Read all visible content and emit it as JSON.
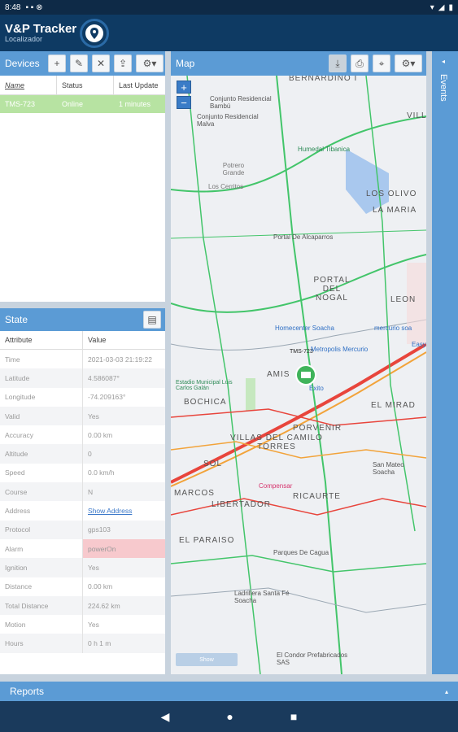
{
  "status": {
    "time": "8:48"
  },
  "app": {
    "title": "V&P Tracker",
    "subtitle": "Localizador"
  },
  "devices": {
    "title": "Devices",
    "columns": [
      "Name",
      "Status",
      "Last Update"
    ],
    "rows": [
      {
        "name": "TMS-723",
        "status": "Online",
        "last_update": "1 minutes"
      }
    ]
  },
  "state": {
    "title": "State",
    "columns": [
      "Attribute",
      "Value"
    ],
    "rows": [
      {
        "attr": "Time",
        "value": "2021-03-03 21:19:22"
      },
      {
        "attr": "Latitude",
        "value": "4.586087°"
      },
      {
        "attr": "Longitude",
        "value": "-74.209163°"
      },
      {
        "attr": "Valid",
        "value": "Yes"
      },
      {
        "attr": "Accuracy",
        "value": "0.00 km"
      },
      {
        "attr": "Altitude",
        "value": "0"
      },
      {
        "attr": "Speed",
        "value": "0.0 km/h"
      },
      {
        "attr": "Course",
        "value": "N"
      },
      {
        "attr": "Address",
        "value": "Show Address"
      },
      {
        "attr": "Protocol",
        "value": "gps103"
      },
      {
        "attr": "Alarm",
        "value": "powerOn"
      },
      {
        "attr": "Ignition",
        "value": "Yes"
      },
      {
        "attr": "Distance",
        "value": "0.00 km"
      },
      {
        "attr": "Total Distance",
        "value": "224.62 km"
      },
      {
        "attr": "Motion",
        "value": "Yes"
      },
      {
        "attr": "Hours",
        "value": "0 h 1 m"
      }
    ]
  },
  "map": {
    "title": "Map",
    "zoom_in": "+",
    "zoom_out": "−",
    "vehicle_label": "TMS-723",
    "labels": {
      "bernardino": "BERNARDINO I",
      "conjunto_bambu": "Conjunto Residencial Bambú",
      "conjunto_malva": "Conjunto Residencial Malva",
      "villa": "VILL",
      "humedal": "Humedal Tibanica",
      "potrero": "Potrero Grande",
      "cerritos": "Los Cerritos",
      "los_olivos": "LOS OLIVO",
      "la_maria": "LA MARIA",
      "portal": "Portal De Alcaparros",
      "portal_nogal": "PORTAL DEL NOGAL",
      "leon": "LEON",
      "homecenter": "Homecenter Soacha",
      "mercurio": "mercurio soa",
      "metropolis": "Metropolis Mercurio",
      "easy": "Easy",
      "amis": "AMIS",
      "estadio": "Estadio Municipal Luis Carlos Galán",
      "exito": "Exito",
      "bochica": "BOCHICA",
      "el_mirador": "EL MIRAD",
      "porvenir": "PORVENIR",
      "villas_camilo": "VILLAS DEL CAMILO TORRES",
      "sol": "SOL",
      "san_mateo": "San Mateo Soacha",
      "marcos": "MARCOS",
      "compensar": "Compensar",
      "ricaurte": "RICAURTE",
      "libertador": "LIBERTADOR",
      "el_paraiso": "EL PARAISO",
      "parques_cagua": "Parques De Cagua",
      "ladrillera": "Ladrillera Santa Fé Soacha",
      "el_condor": "El Condor Prefabricados SAS",
      "map_btn": "Show"
    }
  },
  "events": {
    "label": "Events"
  },
  "reports": {
    "label": "Reports"
  },
  "colors": {
    "header": "#5b9bd5",
    "appbar": "#0e3a63",
    "selected_row": "#b7e3a2",
    "alarm": "#f7c9cd"
  }
}
